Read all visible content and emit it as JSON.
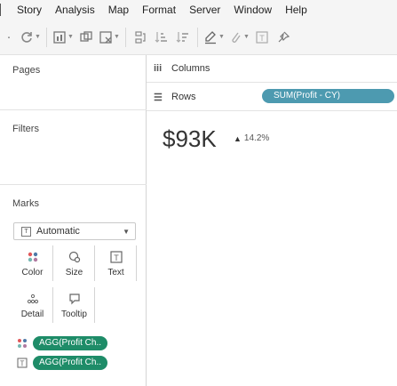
{
  "menu": {
    "items": [
      "Story",
      "Analysis",
      "Map",
      "Format",
      "Server",
      "Window",
      "Help"
    ]
  },
  "toolbar": {
    "icons": [
      "refresh-icon",
      "bar-chart-swap-icon",
      "duplicate-sheet-icon",
      "clear-sheet-icon",
      "group-members-icon",
      "sort-ascending-icon",
      "sort-descending-icon",
      "highlight-icon",
      "annotate-icon",
      "fit-icon",
      "pin-icon"
    ]
  },
  "left": {
    "pages_title": "Pages",
    "filters_title": "Filters",
    "marks_title": "Marks",
    "mark_type": "Automatic",
    "mark_cards": [
      {
        "label": "Color",
        "icon": "color-dots-icon"
      },
      {
        "label": "Size",
        "icon": "size-icon"
      },
      {
        "label": "Text",
        "icon": "text-icon"
      },
      {
        "label": "Detail",
        "icon": "detail-icon"
      },
      {
        "label": "Tooltip",
        "icon": "tooltip-icon"
      }
    ],
    "mark_pills": [
      {
        "label": "AGG(Profit Ch..",
        "icon": "color-dots-icon",
        "color": "#1e8c68"
      },
      {
        "label": "AGG(Profit Ch..",
        "icon": "text-icon",
        "color": "#1e8c68"
      }
    ]
  },
  "shelves": {
    "columns_label": "Columns",
    "rows_label": "Rows",
    "rows_pill": "SUM(Profit - CY)",
    "rows_pill_color": "#4d9ab0"
  },
  "view": {
    "kpi_value": "$93K",
    "delta_arrow": "▲",
    "delta_value": "14.2%"
  }
}
